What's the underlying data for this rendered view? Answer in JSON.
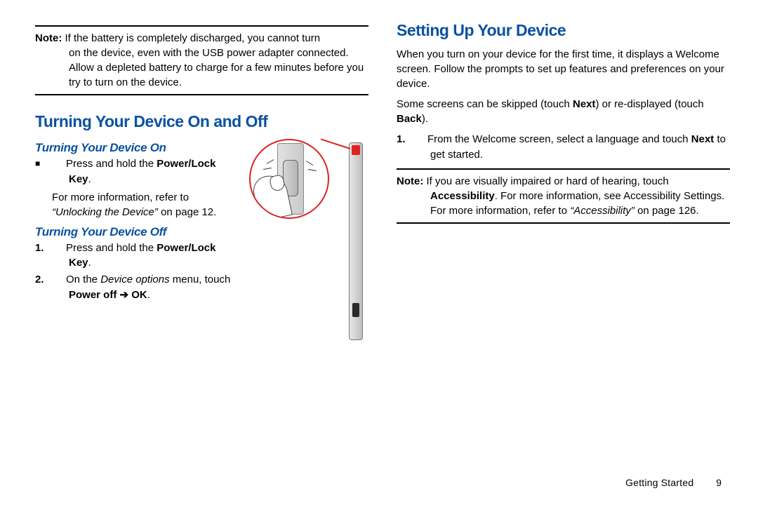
{
  "left": {
    "note1": {
      "label": "Note:",
      "line1": "If the battery is completely discharged, you cannot turn",
      "cont": "on the device, even with the USB power adapter connected. Allow a depleted battery to charge for a few minutes before you try to turn on the device."
    },
    "h_on_off": "Turning Your Device On and Off",
    "h_on": "Turning Your Device On",
    "on_bullet_pre": "Press and hold the ",
    "on_bullet_bold": "Power/Lock Key",
    "on_info_pre": "For more information, refer to ",
    "on_info_quote": "“Unlocking the Device” ",
    "on_info_post": "on page 12.",
    "h_off": "Turning Your Device Off",
    "off_s1_pre": "Press and hold the ",
    "off_s1_bold": "Power/Lock Key",
    "off_s2_pre": "On the ",
    "off_s2_italic": "Device options",
    "off_s2_mid": " menu, touch ",
    "off_s2_bold1": "Power off",
    "off_s2_arrow": " ➔ ",
    "off_s2_bold2": "OK",
    "step1": "1.",
    "step2": "2."
  },
  "right": {
    "h_setup": "Setting Up Your Device",
    "p1": "When you turn on your device for the first time, it displays a Welcome screen. Follow the prompts to set up features and preferences on your device.",
    "p2_a": "Some screens can be skipped (touch ",
    "p2_b1": "Next",
    "p2_b": ") or re-displayed (touch ",
    "p2_b2": "Back",
    "p2_c": ").",
    "s1_a": "From the Welcome screen, select a language and touch ",
    "s1_b": "Next",
    "s1_c": " to get started.",
    "note2": {
      "label": "Note:",
      "a": "If you are visually impaired or hard of hearing, touch ",
      "bold": "Accessibility",
      "b": ". For more information, see Accessibility Settings. For more information, refer to ",
      "quote": "“Accessibility”",
      "c": " on page 126."
    }
  },
  "footer": {
    "section": "Getting Started",
    "page": "9"
  }
}
